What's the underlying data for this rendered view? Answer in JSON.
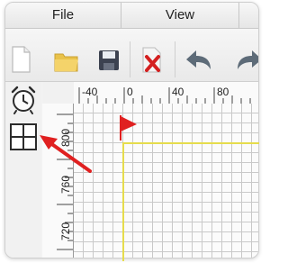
{
  "menubar": {
    "items": [
      {
        "label": "File"
      },
      {
        "label": "View"
      }
    ]
  },
  "toolbar": {
    "buttons": [
      {
        "icon": "new-document-icon"
      },
      {
        "icon": "open-folder-icon"
      },
      {
        "icon": "save-icon"
      },
      {
        "icon": "delete-document-icon"
      },
      {
        "icon": "undo-icon"
      },
      {
        "icon": "redo-icon"
      }
    ]
  },
  "sidebar": {
    "buttons": [
      {
        "icon": "alarm-clock-icon"
      },
      {
        "icon": "grid-icon"
      }
    ]
  },
  "rulers": {
    "horizontal": [
      "-40",
      "0",
      "40",
      "80"
    ],
    "vertical": [
      "800",
      "760",
      "720"
    ]
  },
  "colors": {
    "start_flag": "#e02020",
    "page_outline": "#e6dc4c",
    "annotation_arrow": "#e02020"
  }
}
